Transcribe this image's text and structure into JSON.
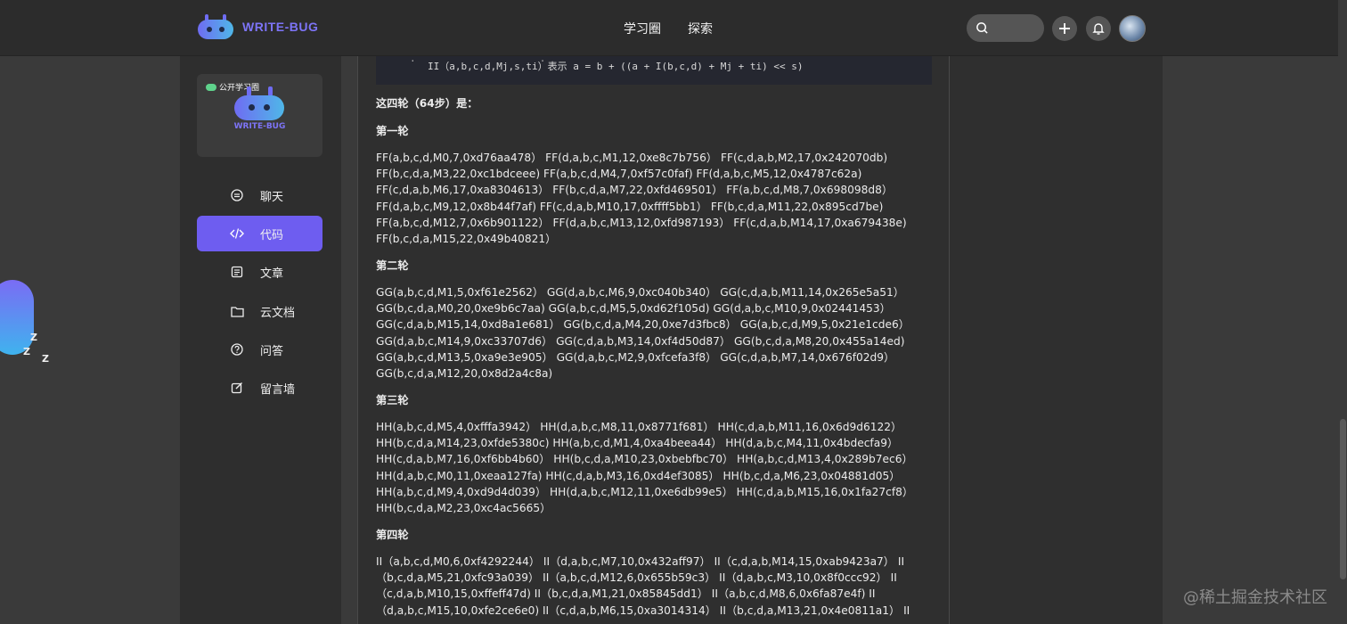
{
  "header": {
    "logo_text": "WRITE-BUG",
    "nav": [
      "学习圈",
      "探索"
    ]
  },
  "sidebar": {
    "card_badge": "公开学习圈",
    "card_name": "WRITE-BUG",
    "items": [
      {
        "label": "聊天",
        "icon": "chat-icon"
      },
      {
        "label": "代码",
        "icon": "code-icon"
      },
      {
        "label": "文章",
        "icon": "article-icon"
      },
      {
        "label": "云文档",
        "icon": "folder-icon"
      },
      {
        "label": "问答",
        "icon": "question-icon"
      },
      {
        "label": "留言墙",
        "icon": "edit-icon"
      }
    ],
    "active_index": 1
  },
  "article": {
    "code_tail": "II（a,b,c,d,Mj,s,ti）表示 a = b + ((a + I(b,c,d) + Mj + ti) << s)",
    "intro": "这四轮（64步）是：",
    "rounds": [
      {
        "title": "第一轮",
        "lines": [
          "FF(a,b,c,d,M0,7,0xd76aa478） FF(d,a,b,c,M1,12,0xe8c7b756） FF(c,d,a,b,M2,17,0x242070db)",
          "FF(b,c,d,a,M3,22,0xc1bdceee) FF(a,b,c,d,M4,7,0xf57c0faf) FF(d,a,b,c,M5,12,0x4787c62a)",
          "FF(c,d,a,b,M6,17,0xa8304613） FF(b,c,d,a,M7,22,0xfd469501） FF(a,b,c,d,M8,7,0x698098d8）",
          "FF(d,a,b,c,M9,12,0x8b44f7af) FF(c,d,a,b,M10,17,0xffff5bb1） FF(b,c,d,a,M11,22,0x895cd7be)",
          "FF(a,b,c,d,M12,7,0x6b901122） FF(d,a,b,c,M13,12,0xfd987193） FF(c,d,a,b,M14,17,0xa679438e)",
          "FF(b,c,d,a,M15,22,0x49b40821）"
        ]
      },
      {
        "title": "第二轮",
        "lines": [
          "GG(a,b,c,d,M1,5,0xf61e2562） GG(d,a,b,c,M6,9,0xc040b340） GG(c,d,a,b,M11,14,0x265e5a51）",
          "GG(b,c,d,a,M0,20,0xe9b6c7aa) GG(a,b,c,d,M5,5,0xd62f105d) GG(d,a,b,c,M10,9,0x02441453）",
          "GG(c,d,a,b,M15,14,0xd8a1e681） GG(b,c,d,a,M4,20,0xe7d3fbc8） GG(a,b,c,d,M9,5,0x21e1cde6）",
          "GG(d,a,b,c,M14,9,0xc33707d6） GG(c,d,a,b,M3,14,0xf4d50d87） GG(b,c,d,a,M8,20,0x455a14ed)",
          "GG(a,b,c,d,M13,5,0xa9e3e905） GG(d,a,b,c,M2,9,0xfcefa3f8） GG(c,d,a,b,M7,14,0x676f02d9）",
          "GG(b,c,d,a,M12,20,0x8d2a4c8a)"
        ]
      },
      {
        "title": "第三轮",
        "lines": [
          "HH(a,b,c,d,M5,4,0xfffa3942） HH(d,a,b,c,M8,11,0x8771f681） HH(c,d,a,b,M11,16,0x6d9d6122）",
          "HH(b,c,d,a,M14,23,0xfde5380c) HH(a,b,c,d,M1,4,0xa4beea44） HH(d,a,b,c,M4,11,0x4bdecfa9）",
          "HH(c,d,a,b,M7,16,0xf6bb4b60） HH(b,c,d,a,M10,23,0xbebfbc70） HH(a,b,c,d,M13,4,0x289b7ec6）",
          "HH(d,a,b,c,M0,11,0xeaa127fa) HH(c,d,a,b,M3,16,0xd4ef3085） HH(b,c,d,a,M6,23,0x04881d05）",
          "HH(a,b,c,d,M9,4,0xd9d4d039） HH(d,a,b,c,M12,11,0xe6db99e5） HH(c,d,a,b,M15,16,0x1fa27cf8）",
          "HH(b,c,d,a,M2,23,0xc4ac5665）"
        ]
      },
      {
        "title": "第四轮",
        "lines": [
          "II（a,b,c,d,M0,6,0xf4292244） II（d,a,b,c,M7,10,0x432aff97） II（c,d,a,b,M14,15,0xab9423a7） II",
          "（b,c,d,a,M5,21,0xfc93a039） II（a,b,c,d,M12,6,0x655b59c3） II（d,a,b,c,M3,10,0x8f0ccc92） II",
          "（c,d,a,b,M10,15,0xffeff47d) II（b,c,d,a,M1,21,0x85845dd1） II（a,b,c,d,M8,6,0x6fa87e4f) II",
          "（d,a,b,c,M15,10,0xfe2ce6e0) II（c,d,a,b,M6,15,0xa3014314） II（b,c,d,a,M13,21,0x4e0811a1） II"
        ]
      }
    ]
  },
  "mascot_letters": [
    "Z",
    "Z",
    "Z"
  ],
  "watermark": "@稀土掘金技术社区",
  "colors": {
    "accent": "#6e5df0",
    "brand_text": "#7d74f7",
    "topbar": "#2c2c2c",
    "panel": "#2f2f2f",
    "background": "#3a3a3a"
  }
}
